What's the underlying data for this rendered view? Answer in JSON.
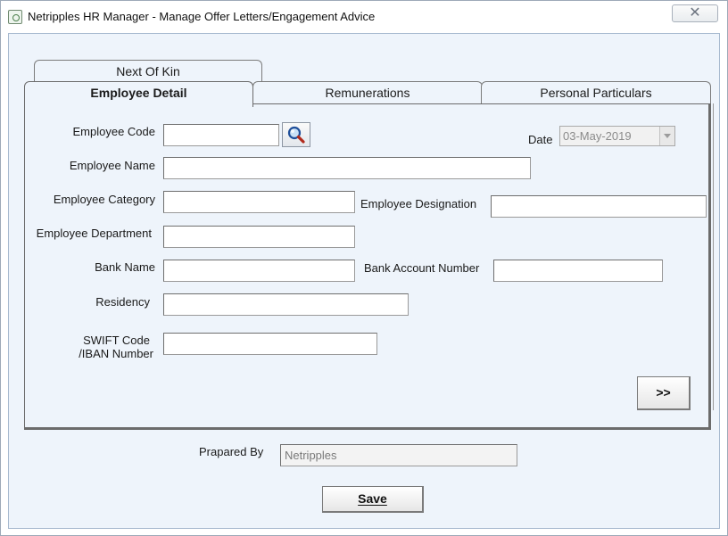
{
  "window": {
    "title": "Netripples HR Manager - Manage Offer Letters/Engagement Advice",
    "close_label": "✕"
  },
  "tabs": {
    "next_of_kin": "Next Of Kin",
    "employee_detail": "Employee Detail",
    "remunerations": "Remunerations",
    "personal_particulars": "Personal Particulars",
    "active": "employee_detail"
  },
  "form": {
    "employee_code": {
      "label": "Employee Code",
      "value": ""
    },
    "date": {
      "label": "Date",
      "value": "03-May-2019"
    },
    "employee_name": {
      "label": "Employee Name",
      "value": ""
    },
    "employee_category": {
      "label": "Employee Category",
      "value": ""
    },
    "employee_designation": {
      "label": "Employee Designation",
      "value": ""
    },
    "employee_department": {
      "label": "Employee Department",
      "value": ""
    },
    "bank_name": {
      "label": "Bank Name",
      "value": ""
    },
    "bank_account_number": {
      "label": "Bank Account Number",
      "value": ""
    },
    "residency": {
      "label": "Residency",
      "value": ""
    },
    "swift_line1": "SWIFT Code",
    "swift_line2": "/IBAN Number",
    "swift_value": "",
    "next_button": ">>"
  },
  "footer": {
    "prepared_by_label": "Prapared By",
    "prepared_by_value": "Netripples",
    "save_label": "Save"
  },
  "icons": {
    "search": "magnifier-icon",
    "app": "app-icon"
  }
}
